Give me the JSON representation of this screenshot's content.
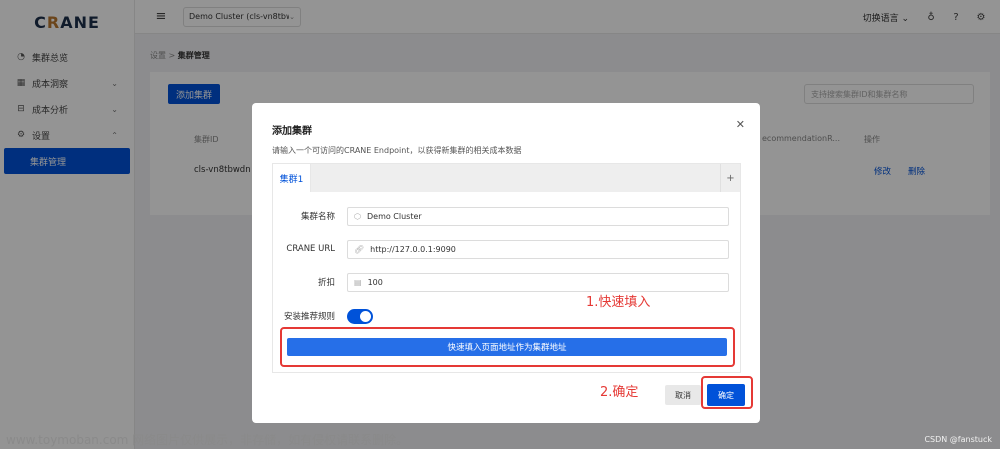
{
  "logo": {
    "prefix": "C",
    "highlight": "R",
    "suffix": "ANE"
  },
  "sidebar": {
    "items": [
      {
        "label": "集群总览",
        "icon": "gauge-icon"
      },
      {
        "label": "成本洞察",
        "icon": "chart-icon"
      },
      {
        "label": "成本分析",
        "icon": "layout-icon"
      },
      {
        "label": "设置",
        "icon": "gear-icon"
      },
      {
        "label": "集群管理"
      }
    ]
  },
  "header": {
    "cluster_select": "Demo Cluster (cls-vn8tbwc",
    "language": "切换语言"
  },
  "breadcrumb": {
    "parent": "设置",
    "current": "集群管理"
  },
  "panel": {
    "add_button": "添加集群",
    "search_placeholder": "支持搜索集群ID和集群名称",
    "headers": {
      "cluster_id": "集群ID",
      "recommendation": "ecommendationR...",
      "actions": "操作"
    },
    "row": {
      "cluster_id": "cls-vn8tbwdn",
      "edit": "修改",
      "delete": "删除"
    }
  },
  "dialog": {
    "title": "添加集群",
    "description": "请输入一个可访问的CRANE Endpoint，以获得新集群的相关成本数据",
    "tab_label": "集群1",
    "tab_add": "+",
    "fields": {
      "name_label": "集群名称",
      "name_value": "Demo Cluster",
      "url_label": "CRANE URL",
      "url_value": "http://127.0.0.1:9090",
      "discount_label": "折扣",
      "discount_value": "100",
      "rules_label": "安装推荐规则"
    },
    "fill_button": "快速填入页面地址作为集群地址",
    "cancel": "取消",
    "confirm": "确定"
  },
  "annotations": {
    "step1": "1.快速填入",
    "step2": "2.确定"
  },
  "footer": {
    "watermark": "www.toymoban.com 网络图片仅供展示，非存储，如有侵权请联系删除。",
    "credit": "CSDN @fanstuck"
  },
  "colors": {
    "primary": "#0052d9",
    "annotation": "#e53935"
  }
}
